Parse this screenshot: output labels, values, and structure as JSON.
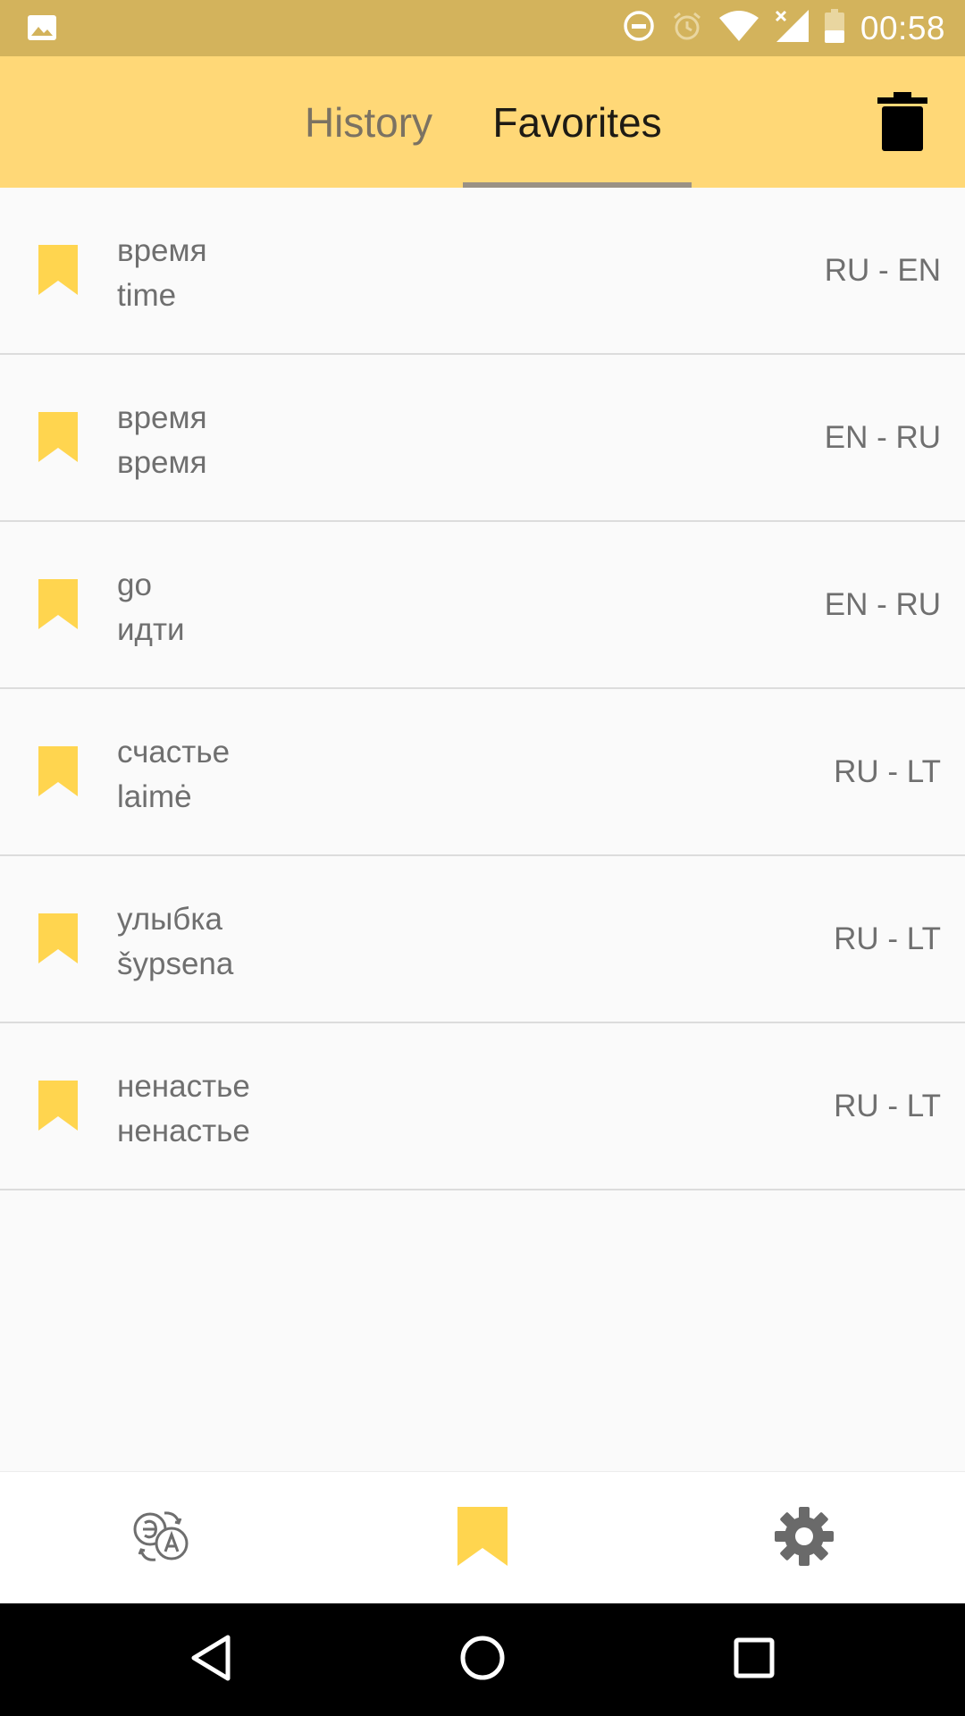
{
  "status_bar": {
    "time": "00:58",
    "icons": [
      "gallery-icon",
      "dnd-icon",
      "alarm-icon",
      "wifi-icon",
      "signal-icon",
      "battery-icon"
    ]
  },
  "header": {
    "tabs": [
      {
        "label": "History",
        "active": false
      },
      {
        "label": "Favorites",
        "active": true
      }
    ],
    "action_icon": "trash-icon"
  },
  "favorites": [
    {
      "source": "время",
      "translation": "time",
      "langs": "RU - EN"
    },
    {
      "source": "время",
      "translation": "время",
      "langs": "EN - RU"
    },
    {
      "source": "go",
      "translation": "идти",
      "langs": "EN - RU"
    },
    {
      "source": "счастье",
      "translation": "laimė",
      "langs": "RU - LT"
    },
    {
      "source": "улыбка",
      "translation": "šypsena",
      "langs": "RU - LT"
    },
    {
      "source": "ненастье",
      "translation": "ненастье",
      "langs": "RU - LT"
    }
  ],
  "bottom_nav": {
    "items": [
      {
        "icon": "translate-icon",
        "active": false
      },
      {
        "icon": "bookmark-icon",
        "active": true
      },
      {
        "icon": "gear-icon",
        "active": false
      }
    ]
  },
  "colors": {
    "status_bar": "#d3b35c",
    "app_bar": "#ffd877",
    "accent": "#ffd54f",
    "indicator": "#9a9184"
  }
}
